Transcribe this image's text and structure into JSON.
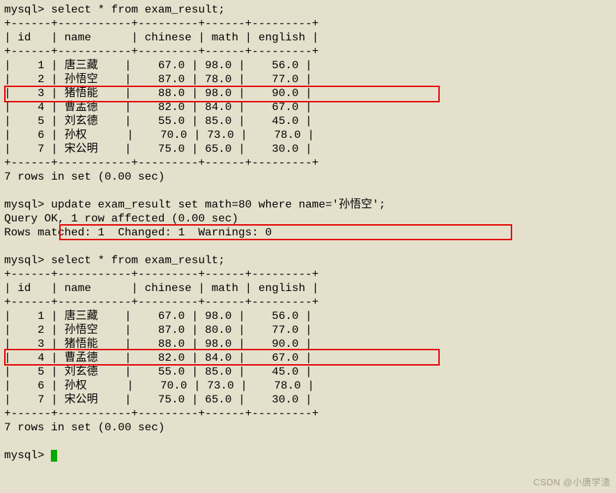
{
  "prompt": "mysql>",
  "queries": {
    "select": "select * from exam_result;",
    "update": "update exam_result set math=80 where name='孙悟空';"
  },
  "table1": {
    "headers": [
      "id",
      "name",
      "chinese",
      "math",
      "english"
    ],
    "rows": [
      {
        "id": "1",
        "name": "唐三藏",
        "chinese": "67.0",
        "math": "98.0",
        "english": "56.0"
      },
      {
        "id": "2",
        "name": "孙悟空",
        "chinese": "87.0",
        "math": "78.0",
        "english": "77.0"
      },
      {
        "id": "3",
        "name": "猪悟能",
        "chinese": "88.0",
        "math": "98.0",
        "english": "90.0"
      },
      {
        "id": "4",
        "name": "曹孟德",
        "chinese": "82.0",
        "math": "84.0",
        "english": "67.0"
      },
      {
        "id": "5",
        "name": "刘玄德",
        "chinese": "55.0",
        "math": "85.0",
        "english": "45.0"
      },
      {
        "id": "6",
        "name": "孙权",
        "chinese": "70.0",
        "math": "73.0",
        "english": "78.0"
      },
      {
        "id": "7",
        "name": "宋公明",
        "chinese": "75.0",
        "math": "65.0",
        "english": "30.0"
      }
    ],
    "footer": "7 rows in set (0.00 sec)"
  },
  "update_response": {
    "line1": "Query OK, 1 row affected (0.00 sec)",
    "line2": "Rows matched: 1  Changed: 1  Warnings: 0"
  },
  "table2": {
    "headers": [
      "id",
      "name",
      "chinese",
      "math",
      "english"
    ],
    "rows": [
      {
        "id": "1",
        "name": "唐三藏",
        "chinese": "67.0",
        "math": "98.0",
        "english": "56.0"
      },
      {
        "id": "2",
        "name": "孙悟空",
        "chinese": "87.0",
        "math": "80.0",
        "english": "77.0"
      },
      {
        "id": "3",
        "name": "猪悟能",
        "chinese": "88.0",
        "math": "98.0",
        "english": "90.0"
      },
      {
        "id": "4",
        "name": "曹孟德",
        "chinese": "82.0",
        "math": "84.0",
        "english": "67.0"
      },
      {
        "id": "5",
        "name": "刘玄德",
        "chinese": "55.0",
        "math": "85.0",
        "english": "45.0"
      },
      {
        "id": "6",
        "name": "孙权",
        "chinese": "70.0",
        "math": "73.0",
        "english": "78.0"
      },
      {
        "id": "7",
        "name": "宋公明",
        "chinese": "75.0",
        "math": "65.0",
        "english": "30.0"
      }
    ],
    "footer": "7 rows in set (0.00 sec)"
  },
  "sep": "+------+-----------+---------+------+---------+",
  "watermark": "CSDN @小唐学渣"
}
